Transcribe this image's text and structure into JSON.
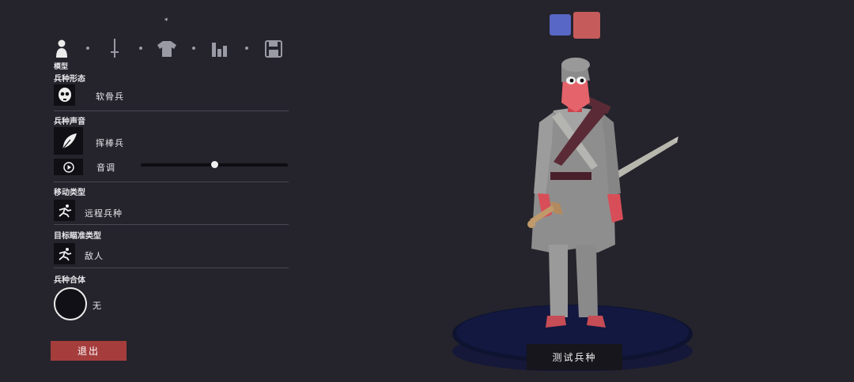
{
  "tabs": {
    "star": "*",
    "model_label": "模型",
    "icons": [
      "person-icon",
      "sword-icon",
      "shirt-icon",
      "bar-chart-icon",
      "save-icon"
    ]
  },
  "sections": {
    "form": {
      "title": "兵种形态",
      "value": "软骨兵",
      "icon": "skull-face-icon"
    },
    "voice": {
      "title": "兵种声音",
      "value": "挥棒兵",
      "icon": "feather-icon",
      "pitch_label": "音调",
      "pitch_level": 0.5
    },
    "movement": {
      "title": "移动类型",
      "value": "远程兵种",
      "icon": "running-figure-icon"
    },
    "targeting": {
      "title": "目标瞄准类型",
      "value": "敌人",
      "icon": "running-figure-icon"
    },
    "merge": {
      "title": "兵种合体",
      "value": "无"
    }
  },
  "buttons": {
    "exit": "退出",
    "test": "测试兵种"
  },
  "colors": {
    "background": "#25242c",
    "team_blue": "#5866c5",
    "team_red": "#c55b5b",
    "exit_button": "#a63d3d"
  }
}
